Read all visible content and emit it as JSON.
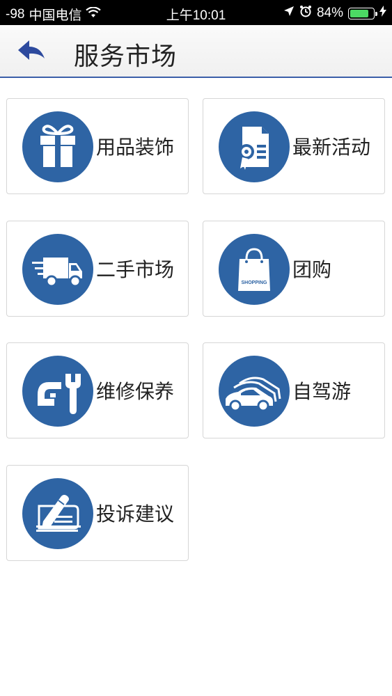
{
  "status_bar": {
    "signal": "-98",
    "carrier": "中国电信",
    "time": "上午10:01",
    "battery": "84%",
    "battery_level": 0.84
  },
  "header": {
    "title": "服务市场"
  },
  "tiles": [
    {
      "label": "用品装饰",
      "icon": "gift-icon"
    },
    {
      "label": "最新活动",
      "icon": "certificate-icon"
    },
    {
      "label": "二手市场",
      "icon": "delivery-truck-icon"
    },
    {
      "label": "团购",
      "icon": "shopping-bag-icon",
      "icon_text": "SHOPPING"
    },
    {
      "label": "维修保养",
      "icon": "repair-tools-icon"
    },
    {
      "label": "自驾游",
      "icon": "cars-icon"
    },
    {
      "label": "投诉建议",
      "icon": "edit-note-icon"
    }
  ],
  "colors": {
    "icon_circle": "#2e64a4",
    "header_border": "#3a5ea8",
    "back_arrow": "#2d4a9e"
  }
}
